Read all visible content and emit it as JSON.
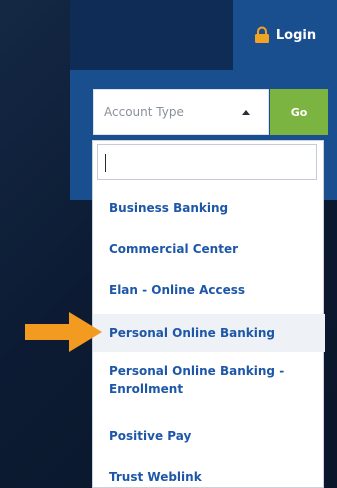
{
  "header": {
    "login_label": "Login",
    "icon": "lock-icon"
  },
  "form": {
    "select_placeholder": "Account Type",
    "go_label": "Go",
    "search_value": ""
  },
  "options": [
    "Business Banking",
    "Commercial Center",
    "Elan - Online Access",
    "Personal Online Banking",
    "Personal Online Banking - Enrollment",
    "Positive Pay",
    "Trust Weblink"
  ],
  "highlighted_option": "Personal Online Banking",
  "colors": {
    "accent_blue": "#1a4f8f",
    "go_green": "#7bb441",
    "option_text": "#1e57a8",
    "arrow_orange": "#f39a21",
    "lock_gold": "#f3a324"
  }
}
